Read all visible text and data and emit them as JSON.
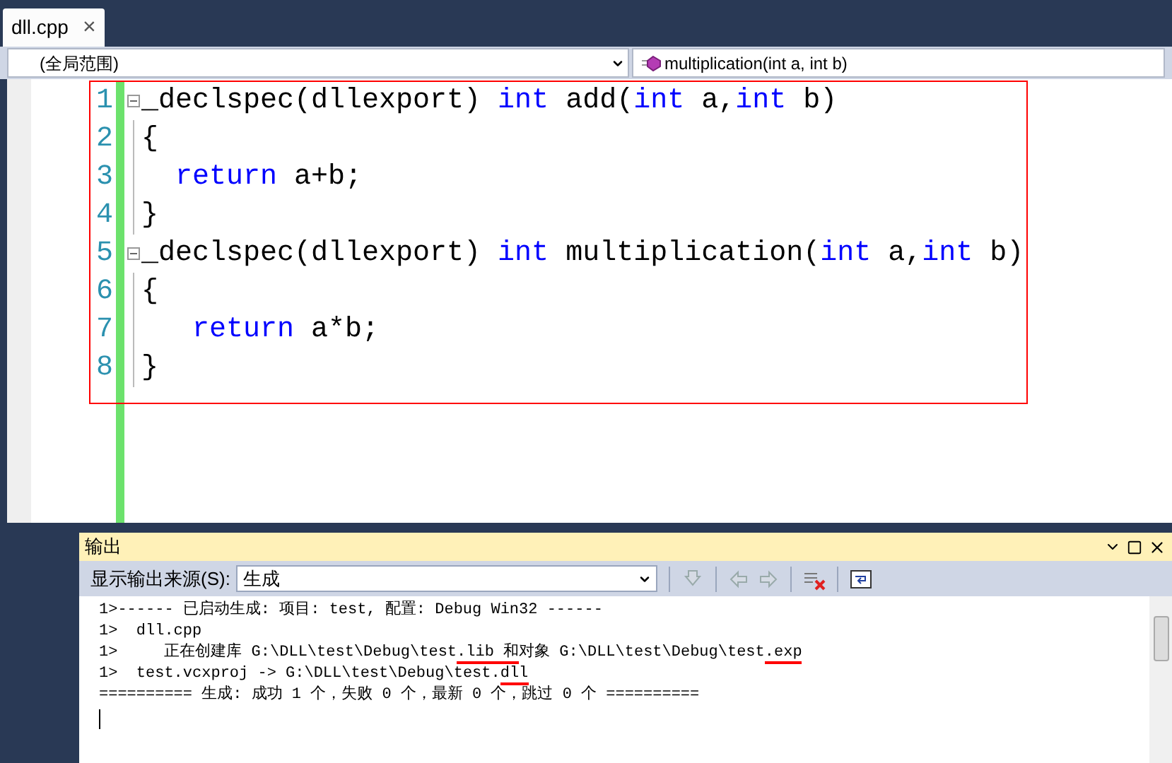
{
  "tabs": [
    {
      "label": "dll.cpp",
      "selected": true,
      "close": "×"
    }
  ],
  "navigation": {
    "scope": "(全局范围)",
    "member": "multiplication(int a, int b)"
  },
  "code_lines": [
    {
      "number": "1",
      "foldable": true,
      "tokens": [
        {
          "text": "_declspec(dllexport) ",
          "kind": "plain"
        },
        {
          "text": "int",
          "kind": "keyword"
        },
        {
          "text": " add(",
          "kind": "plain"
        },
        {
          "text": "int",
          "kind": "keyword"
        },
        {
          "text": " a,",
          "kind": "plain"
        },
        {
          "text": "int",
          "kind": "keyword"
        },
        {
          "text": " b)",
          "kind": "plain"
        }
      ]
    },
    {
      "number": "2",
      "foldable": false,
      "tokens": [
        {
          "text": "{",
          "kind": "plain"
        }
      ]
    },
    {
      "number": "3",
      "foldable": false,
      "tokens": [
        {
          "text": "  return",
          "kind": "keyword"
        },
        {
          "text": " a+b;",
          "kind": "plain"
        }
      ]
    },
    {
      "number": "4",
      "foldable": false,
      "tokens": [
        {
          "text": "}",
          "kind": "plain"
        }
      ]
    },
    {
      "number": "5",
      "foldable": true,
      "tokens": [
        {
          "text": "_declspec(dllexport) ",
          "kind": "plain"
        },
        {
          "text": "int",
          "kind": "keyword"
        },
        {
          "text": " multiplication(",
          "kind": "plain"
        },
        {
          "text": "int",
          "kind": "keyword"
        },
        {
          "text": " a,",
          "kind": "plain"
        },
        {
          "text": "int",
          "kind": "keyword"
        },
        {
          "text": " b)",
          "kind": "plain"
        }
      ]
    },
    {
      "number": "6",
      "foldable": false,
      "tokens": [
        {
          "text": "{",
          "kind": "plain"
        }
      ]
    },
    {
      "number": "7",
      "foldable": false,
      "tokens": [
        {
          "text": "   return",
          "kind": "keyword"
        },
        {
          "text": " a*b;",
          "kind": "plain"
        }
      ]
    },
    {
      "number": "8",
      "foldable": false,
      "tokens": [
        {
          "text": "}",
          "kind": "plain"
        }
      ]
    }
  ],
  "output_panel": {
    "title": "输出",
    "source_label": "显示输出来源(S):",
    "source_value": "生成",
    "lines": [
      {
        "segments": [
          {
            "text": "1>------ 已启动生成: 项目: test, 配置: Debug Win32 ------",
            "marked": false
          }
        ]
      },
      {
        "segments": [
          {
            "text": "1>  dll.cpp",
            "marked": false
          }
        ]
      },
      {
        "segments": [
          {
            "text": "1>     正在创建库 G:\\DLL\\test\\Debug\\test",
            "marked": false
          },
          {
            "text": ".lib 和",
            "marked": true
          },
          {
            "text": "对象 G:\\DLL\\test\\Debug\\test",
            "marked": false
          },
          {
            "text": ".exp",
            "marked": true
          }
        ]
      },
      {
        "segments": [
          {
            "text": "1>  test.vcxproj -> G:\\DLL\\test\\Debug\\test.",
            "marked": false
          },
          {
            "text": "dll",
            "marked": true
          }
        ]
      },
      {
        "segments": [
          {
            "text": "========== 生成: 成功 1 个，失败 0 个，最新 0 个，跳过 0 个 ==========",
            "marked": false
          }
        ]
      }
    ]
  }
}
